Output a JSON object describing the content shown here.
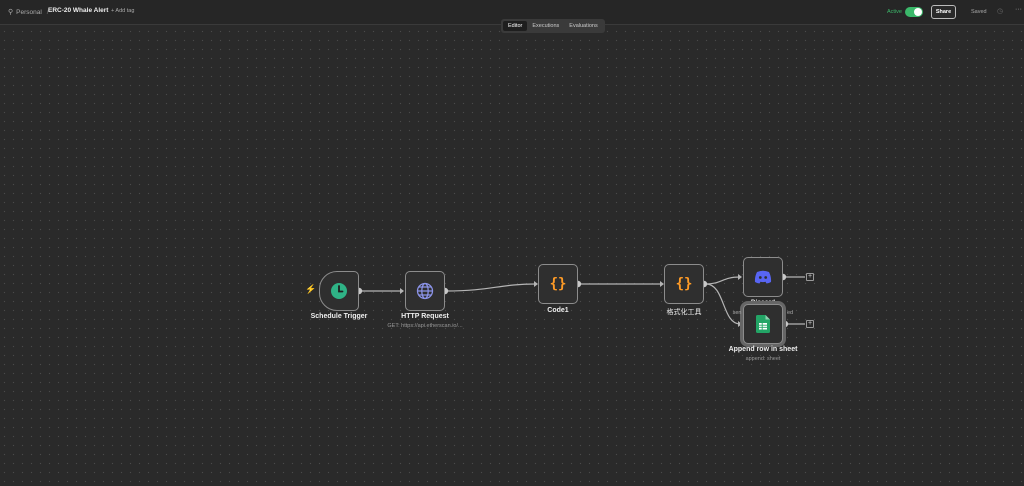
{
  "header": {
    "project": "Personal",
    "workflow_name": "ERC-20 Whale Alert",
    "add_tag": "+ Add tag",
    "active_label": "Active",
    "share_label": "Share",
    "saved_label": "Saved"
  },
  "tabs": [
    {
      "label": "Editor",
      "active": true
    },
    {
      "label": "Executions",
      "active": false
    },
    {
      "label": "Evaluations",
      "active": false
    }
  ],
  "nodes": {
    "schedule": {
      "label": "Schedule Trigger",
      "icon": "clock-icon"
    },
    "http": {
      "label": "HTTP Request",
      "subtitle": "GET: https://api.etherscan.io/...",
      "icon": "globe-icon"
    },
    "code1": {
      "label": "Code1",
      "icon": "code-braces-icon"
    },
    "format": {
      "label": "格式化工具",
      "icon": "code-braces-icon"
    },
    "discord": {
      "label": "Discord",
      "icon": "discord-icon"
    },
    "sheets": {
      "label": "Append row in sheet",
      "subtitle": "append: sheet",
      "icon": "google-sheets-icon"
    }
  },
  "overlap_text": {
    "left": "sen",
    "right": "ed"
  },
  "colors": {
    "canvas": "#2a2a2a",
    "accent_active": "#3bb86a",
    "code_orange": "#ff9b26",
    "discord_blue": "#5865f2",
    "sheets_green": "#23a566",
    "trigger_bolt": "#e0533d"
  }
}
